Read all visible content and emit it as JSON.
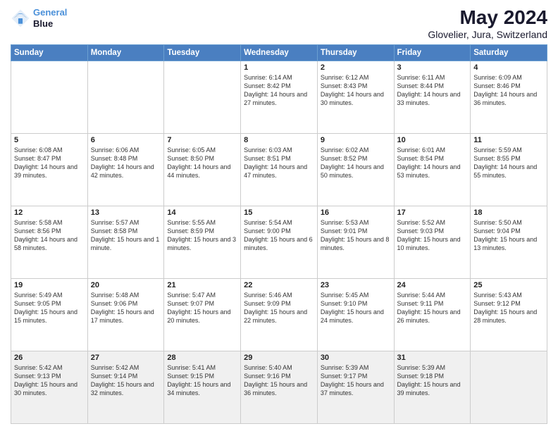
{
  "header": {
    "logo_line1": "General",
    "logo_line2": "Blue",
    "main_title": "May 2024",
    "sub_title": "Glovelier, Jura, Switzerland"
  },
  "days_of_week": [
    "Sunday",
    "Monday",
    "Tuesday",
    "Wednesday",
    "Thursday",
    "Friday",
    "Saturday"
  ],
  "weeks": [
    [
      {
        "day": "",
        "info": ""
      },
      {
        "day": "",
        "info": ""
      },
      {
        "day": "",
        "info": ""
      },
      {
        "day": "1",
        "info": "Sunrise: 6:14 AM\nSunset: 8:42 PM\nDaylight: 14 hours\nand 27 minutes."
      },
      {
        "day": "2",
        "info": "Sunrise: 6:12 AM\nSunset: 8:43 PM\nDaylight: 14 hours\nand 30 minutes."
      },
      {
        "day": "3",
        "info": "Sunrise: 6:11 AM\nSunset: 8:44 PM\nDaylight: 14 hours\nand 33 minutes."
      },
      {
        "day": "4",
        "info": "Sunrise: 6:09 AM\nSunset: 8:46 PM\nDaylight: 14 hours\nand 36 minutes."
      }
    ],
    [
      {
        "day": "5",
        "info": "Sunrise: 6:08 AM\nSunset: 8:47 PM\nDaylight: 14 hours\nand 39 minutes."
      },
      {
        "day": "6",
        "info": "Sunrise: 6:06 AM\nSunset: 8:48 PM\nDaylight: 14 hours\nand 42 minutes."
      },
      {
        "day": "7",
        "info": "Sunrise: 6:05 AM\nSunset: 8:50 PM\nDaylight: 14 hours\nand 44 minutes."
      },
      {
        "day": "8",
        "info": "Sunrise: 6:03 AM\nSunset: 8:51 PM\nDaylight: 14 hours\nand 47 minutes."
      },
      {
        "day": "9",
        "info": "Sunrise: 6:02 AM\nSunset: 8:52 PM\nDaylight: 14 hours\nand 50 minutes."
      },
      {
        "day": "10",
        "info": "Sunrise: 6:01 AM\nSunset: 8:54 PM\nDaylight: 14 hours\nand 53 minutes."
      },
      {
        "day": "11",
        "info": "Sunrise: 5:59 AM\nSunset: 8:55 PM\nDaylight: 14 hours\nand 55 minutes."
      }
    ],
    [
      {
        "day": "12",
        "info": "Sunrise: 5:58 AM\nSunset: 8:56 PM\nDaylight: 14 hours\nand 58 minutes."
      },
      {
        "day": "13",
        "info": "Sunrise: 5:57 AM\nSunset: 8:58 PM\nDaylight: 15 hours\nand 1 minute."
      },
      {
        "day": "14",
        "info": "Sunrise: 5:55 AM\nSunset: 8:59 PM\nDaylight: 15 hours\nand 3 minutes."
      },
      {
        "day": "15",
        "info": "Sunrise: 5:54 AM\nSunset: 9:00 PM\nDaylight: 15 hours\nand 6 minutes."
      },
      {
        "day": "16",
        "info": "Sunrise: 5:53 AM\nSunset: 9:01 PM\nDaylight: 15 hours\nand 8 minutes."
      },
      {
        "day": "17",
        "info": "Sunrise: 5:52 AM\nSunset: 9:03 PM\nDaylight: 15 hours\nand 10 minutes."
      },
      {
        "day": "18",
        "info": "Sunrise: 5:50 AM\nSunset: 9:04 PM\nDaylight: 15 hours\nand 13 minutes."
      }
    ],
    [
      {
        "day": "19",
        "info": "Sunrise: 5:49 AM\nSunset: 9:05 PM\nDaylight: 15 hours\nand 15 minutes."
      },
      {
        "day": "20",
        "info": "Sunrise: 5:48 AM\nSunset: 9:06 PM\nDaylight: 15 hours\nand 17 minutes."
      },
      {
        "day": "21",
        "info": "Sunrise: 5:47 AM\nSunset: 9:07 PM\nDaylight: 15 hours\nand 20 minutes."
      },
      {
        "day": "22",
        "info": "Sunrise: 5:46 AM\nSunset: 9:09 PM\nDaylight: 15 hours\nand 22 minutes."
      },
      {
        "day": "23",
        "info": "Sunrise: 5:45 AM\nSunset: 9:10 PM\nDaylight: 15 hours\nand 24 minutes."
      },
      {
        "day": "24",
        "info": "Sunrise: 5:44 AM\nSunset: 9:11 PM\nDaylight: 15 hours\nand 26 minutes."
      },
      {
        "day": "25",
        "info": "Sunrise: 5:43 AM\nSunset: 9:12 PM\nDaylight: 15 hours\nand 28 minutes."
      }
    ],
    [
      {
        "day": "26",
        "info": "Sunrise: 5:42 AM\nSunset: 9:13 PM\nDaylight: 15 hours\nand 30 minutes."
      },
      {
        "day": "27",
        "info": "Sunrise: 5:42 AM\nSunset: 9:14 PM\nDaylight: 15 hours\nand 32 minutes."
      },
      {
        "day": "28",
        "info": "Sunrise: 5:41 AM\nSunset: 9:15 PM\nDaylight: 15 hours\nand 34 minutes."
      },
      {
        "day": "29",
        "info": "Sunrise: 5:40 AM\nSunset: 9:16 PM\nDaylight: 15 hours\nand 36 minutes."
      },
      {
        "day": "30",
        "info": "Sunrise: 5:39 AM\nSunset: 9:17 PM\nDaylight: 15 hours\nand 37 minutes."
      },
      {
        "day": "31",
        "info": "Sunrise: 5:39 AM\nSunset: 9:18 PM\nDaylight: 15 hours\nand 39 minutes."
      },
      {
        "day": "",
        "info": ""
      }
    ]
  ]
}
